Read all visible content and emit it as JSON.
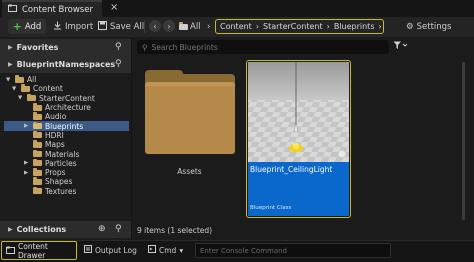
{
  "window": {
    "tab_title": "Content Browser",
    "close_glyph": "×"
  },
  "toolbar": {
    "add_label": "Add",
    "import_label": "Import",
    "save_all_label": "Save All",
    "all_label": "All",
    "settings_label": "Settings"
  },
  "breadcrumb": [
    "Content",
    "StarterContent",
    "Blueprints"
  ],
  "sidebar": {
    "favorites_label": "Favorites",
    "namespace_label": "BlueprintNamespaces",
    "collections_label": "Collections",
    "tree": [
      {
        "label": "All",
        "level": 0,
        "expanded": true
      },
      {
        "label": "Content",
        "level": 1,
        "expanded": true
      },
      {
        "label": "StarterContent",
        "level": 2,
        "expanded": true
      },
      {
        "label": "Architecture",
        "level": 3
      },
      {
        "label": "Audio",
        "level": 3
      },
      {
        "label": "Blueprints",
        "level": 3,
        "selected": true,
        "has_children": true
      },
      {
        "label": "HDRI",
        "level": 3
      },
      {
        "label": "Maps",
        "level": 3
      },
      {
        "label": "Materials",
        "level": 3
      },
      {
        "label": "Particles",
        "level": 3,
        "has_children": true
      },
      {
        "label": "Props",
        "level": 3,
        "has_children": true
      },
      {
        "label": "Shapes",
        "level": 3
      },
      {
        "label": "Textures",
        "level": 3
      }
    ]
  },
  "search": {
    "placeholder": "Search Blueprints"
  },
  "assets": [
    {
      "name": "Assets",
      "kind": "folder"
    },
    {
      "name": "Blueprint_CeilingLight",
      "kind": "blueprint",
      "class_label": "Blueprint Class",
      "selected": true
    }
  ],
  "status": {
    "items_text": "9 items (1 selected)"
  },
  "bottom": {
    "drawer_label": "Content Drawer",
    "output_label": "Output Log",
    "cmd_label": "Cmd",
    "console_placeholder": "Enter Console Command"
  },
  "colors": {
    "highlight": "#c9b930",
    "selection": "#3c5a86",
    "asset_blue": "#0a67cc",
    "folder": "#c8a260",
    "add_green": "#4fc24a"
  }
}
